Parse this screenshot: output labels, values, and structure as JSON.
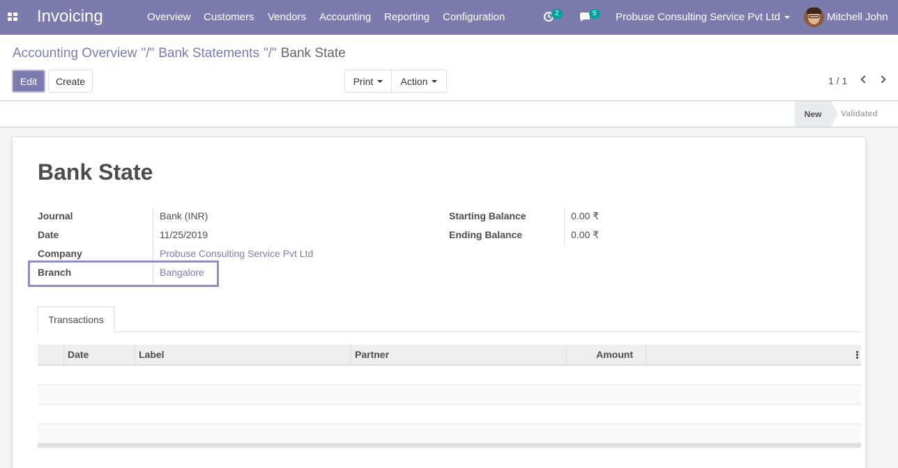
{
  "navbar": {
    "app_name": "Invoicing",
    "menu": [
      "Overview",
      "Customers",
      "Vendors",
      "Accounting",
      "Reporting",
      "Configuration"
    ],
    "activity_count": "2",
    "messages_count": "5",
    "company": "Probuse Consulting Service Pvt Ltd",
    "user": "Mitchell John",
    "bg_color": "#7c7bad"
  },
  "breadcrumb": {
    "items": [
      "Accounting Overview",
      "Bank Statements"
    ],
    "separator": "\"/\"",
    "current": "Bank State"
  },
  "buttons": {
    "edit": "Edit",
    "create": "Create",
    "print": "Print",
    "action": "Action"
  },
  "pager": "1 / 1",
  "status": {
    "stages": [
      "New",
      "Validated"
    ],
    "active": "New"
  },
  "record": {
    "title": "Bank State",
    "fields_left": [
      {
        "label": "Journal",
        "value": "Bank (INR)"
      },
      {
        "label": "Date",
        "value": "11/25/2019"
      },
      {
        "label": "Company",
        "value": "Probuse Consulting Service Pvt Ltd"
      },
      {
        "label": "Branch",
        "value": "Bangalore"
      }
    ],
    "fields_right": [
      {
        "label": "Starting Balance",
        "value": "0.00 ₹"
      },
      {
        "label": "Ending Balance",
        "value": "0.00 ₹"
      }
    ]
  },
  "tabs": [
    "Transactions"
  ],
  "grid": {
    "columns": [
      "Date",
      "Label",
      "Partner",
      "Amount"
    ],
    "rows": []
  }
}
